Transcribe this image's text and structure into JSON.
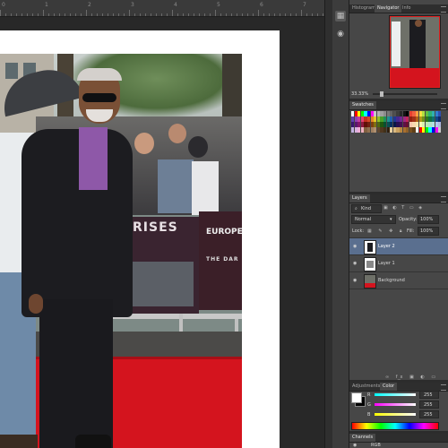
{
  "ruler": {
    "labels": [
      "0",
      "1",
      "2",
      "3",
      "4",
      "5",
      "6",
      "7"
    ]
  },
  "toolstrip": {
    "icons": [
      "color-swatch-icon",
      "navigator-icon",
      "cube-icon"
    ]
  },
  "navigator_panel": {
    "tabs": [
      "Histogram",
      "Navigator",
      "Info"
    ],
    "active_tab": "Navigator",
    "zoom": "33.33%"
  },
  "swatches_panel": {
    "tabs": [
      "Swatches"
    ],
    "colors": [
      "#ffffff",
      "#ff0000",
      "#ffff00",
      "#00ff00",
      "#00ffff",
      "#0000ff",
      "#ff00ff",
      "#c8c8c8",
      "#b4b4b4",
      "#a0a0a0",
      "#8c8c8c",
      "#787878",
      "#646464",
      "#505050",
      "#3c3c3c",
      "#282828",
      "#141414",
      "#000000",
      "#e84030",
      "#f06040",
      "#f8a040",
      "#f8e040",
      "#b0e040",
      "#60c040",
      "#30b070",
      "#30b0b0",
      "#3080d0",
      "#3050b0",
      "#6040b0",
      "#9040b0",
      "#c040a0",
      "#e04070",
      "#c03020",
      "#d04828",
      "#e08828",
      "#e0c828",
      "#90c028",
      "#48a028",
      "#209058",
      "#209090",
      "#2060b0",
      "#203890",
      "#482890",
      "#702890",
      "#a02880",
      "#c02858",
      "#902010",
      "#a03018",
      "#b06018",
      "#b09818",
      "#709018",
      "#307818",
      "#107040",
      "#107070",
      "#104888",
      "#102868",
      "#381870",
      "#581870",
      "#801868",
      "#901840",
      "#601008",
      "#702010",
      "#804010",
      "#807010",
      "#506810",
      "#205810",
      "#085030",
      "#085050",
      "#083060",
      "#081848",
      "#281050",
      "#401050",
      "#601048",
      "#681030",
      "#f8c8b0",
      "#f8d8b0",
      "#f8e8b0",
      "#f8f8b0",
      "#d8f0b0",
      "#b8e8b0",
      "#b0e0c8",
      "#b0e0e0",
      "#b0c8f0",
      "#b0b8e0",
      "#c0b0e0",
      "#d8b0e0",
      "#f0b0d8",
      "#f0b0c0",
      "#806040",
      "#907050",
      "#a08060",
      "#b09070",
      "#604830",
      "#503820",
      "#403018",
      "#302010",
      "#e8d0a0",
      "#d8b880",
      "#c8a060",
      "#b88840",
      "#a87030",
      "#906028",
      "#785020",
      "#604018"
    ],
    "total_cells": 112
  },
  "layers_panel": {
    "tabs": [
      "Layers"
    ],
    "filter_label": "Kind",
    "blend_mode": "Normal",
    "opacity_label": "Opacity:",
    "opacity_value": "100%",
    "lock_label": "Lock:",
    "fill_label": "Fill:",
    "fill_value": "100%",
    "layers": [
      {
        "name": "Layer 2",
        "selected": true
      },
      {
        "name": "Layer 1",
        "selected": false
      },
      {
        "name": "Background",
        "selected": false
      }
    ]
  },
  "adjustments_panel": {
    "tabs": [
      "Adjustments",
      "Color"
    ],
    "active_tab": "Color",
    "channels": [
      {
        "label": "R",
        "value": "255"
      },
      {
        "label": "G",
        "value": "255"
      },
      {
        "label": "B",
        "value": "255"
      }
    ]
  },
  "channels_panel": {
    "tabs": [
      "Channels"
    ],
    "first_channel": "RGB"
  },
  "photo": {
    "banner_text_1": "RISES",
    "banner_text_2": "EUROPE",
    "banner_text_3": "THE DAR"
  }
}
